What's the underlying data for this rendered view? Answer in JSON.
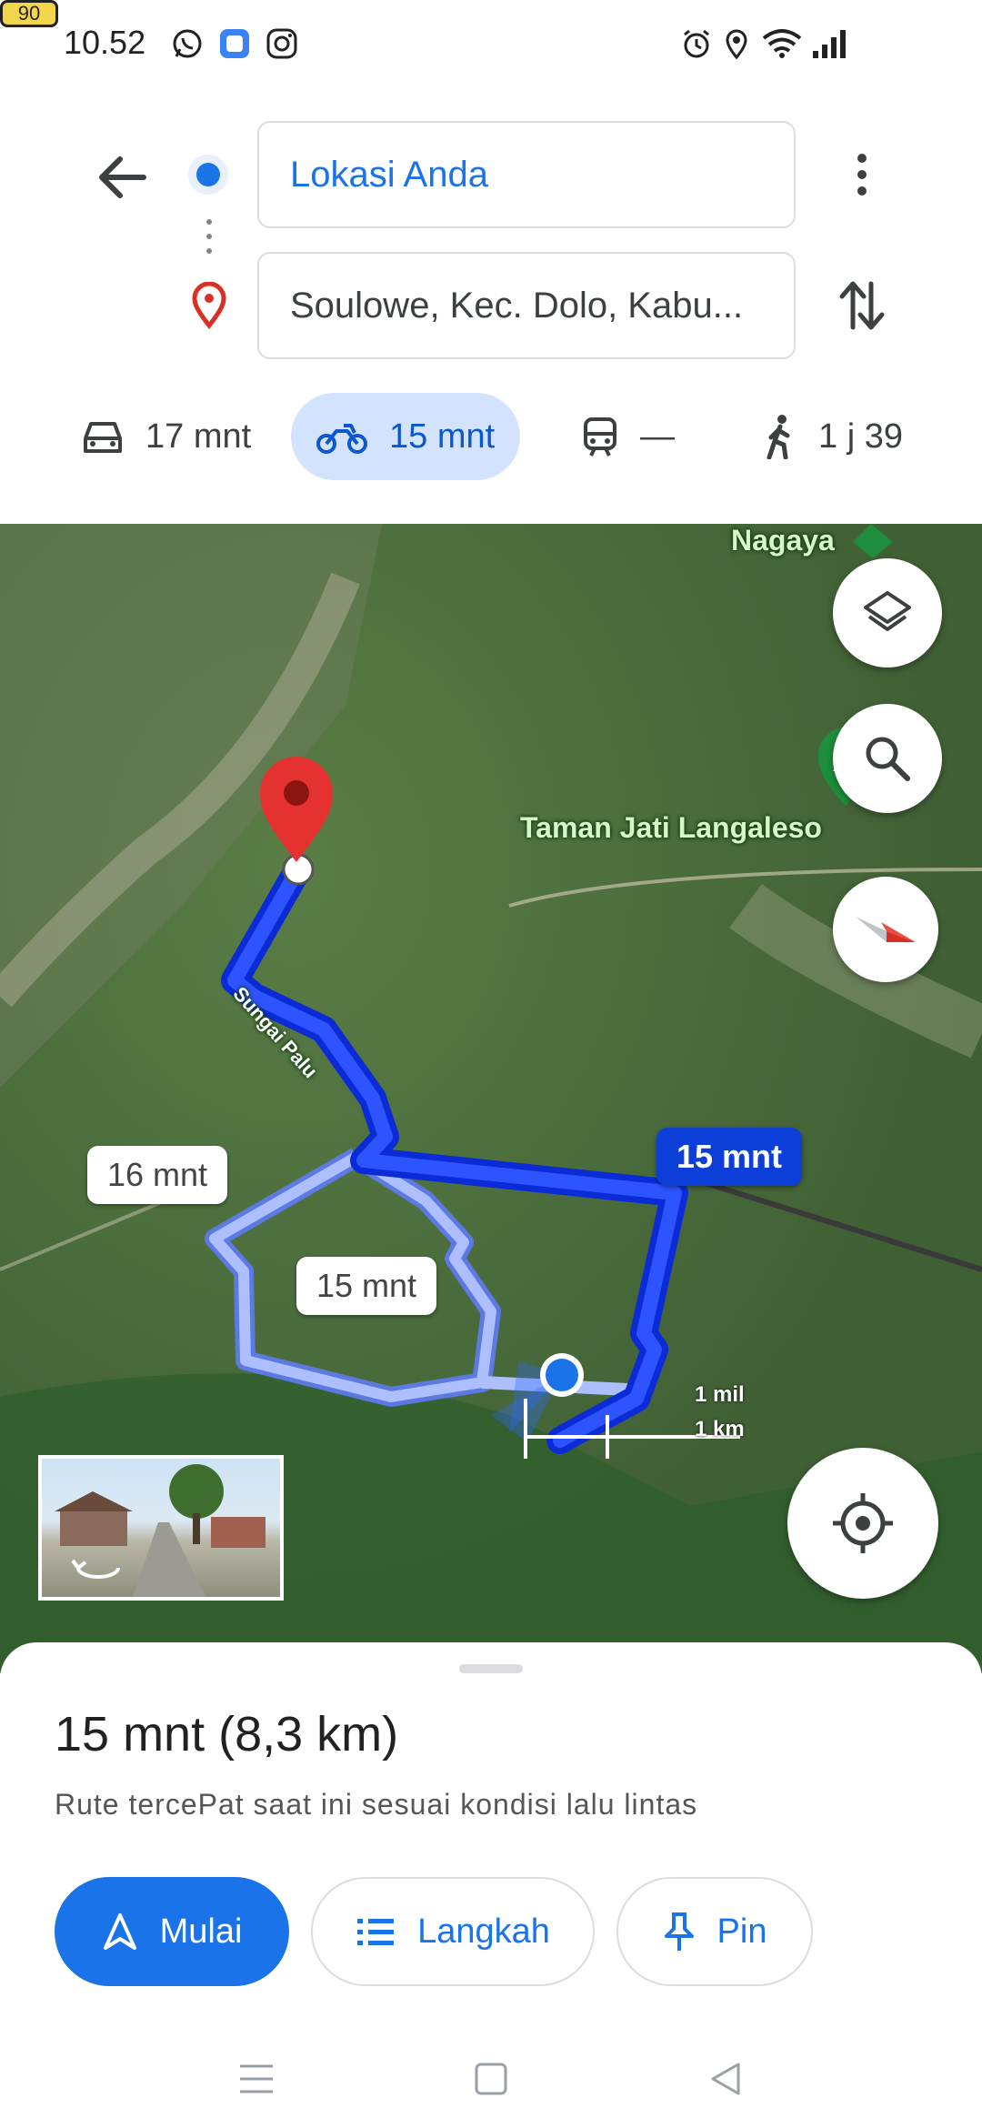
{
  "status_bar": {
    "time": "10.52",
    "battery": "90"
  },
  "search": {
    "origin": "Lokasi Anda",
    "destination": "Soulowe, Kec. Dolo, Kabu..."
  },
  "modes": [
    {
      "name": "car",
      "label": "17 mnt"
    },
    {
      "name": "motorcycle",
      "label": "15 mnt",
      "selected": true
    },
    {
      "name": "transit",
      "label": "—"
    },
    {
      "name": "walk",
      "label": "1 j 39"
    }
  ],
  "map": {
    "places": [
      "Nagaya",
      "Taman Jati Langaleso"
    ],
    "road_label": "Sungai Palu",
    "route_callouts": {
      "main": "15 mnt",
      "alt1": "16 mnt",
      "alt2": "15 mnt"
    },
    "scale": {
      "miles": "1 mil",
      "km": "1 km"
    }
  },
  "sheet": {
    "summary": "15 mnt (8,3 km)",
    "note": "Rute tercePat saat ini sesuai kondisi lalu lintas",
    "start_label": "Mulai",
    "steps_label": "Langkah",
    "pin_label": "Pin"
  },
  "colors": {
    "accent": "#1a73e8",
    "route": "#1f3cff",
    "route_alt": "#8fa8ff",
    "pin": "#e5312f"
  },
  "icons": [
    "whatsapp-icon",
    "app-icon",
    "instagram-icon",
    "alarm-icon",
    "location-icon",
    "wifi-icon",
    "signal-icon",
    "back-arrow-icon",
    "more-icon",
    "swap-icon",
    "car-icon",
    "motorcycle-icon",
    "train-icon",
    "walk-icon",
    "layers-icon",
    "search-icon",
    "compass-icon",
    "my-location-icon",
    "navigate-icon",
    "list-icon",
    "pin-icon"
  ]
}
